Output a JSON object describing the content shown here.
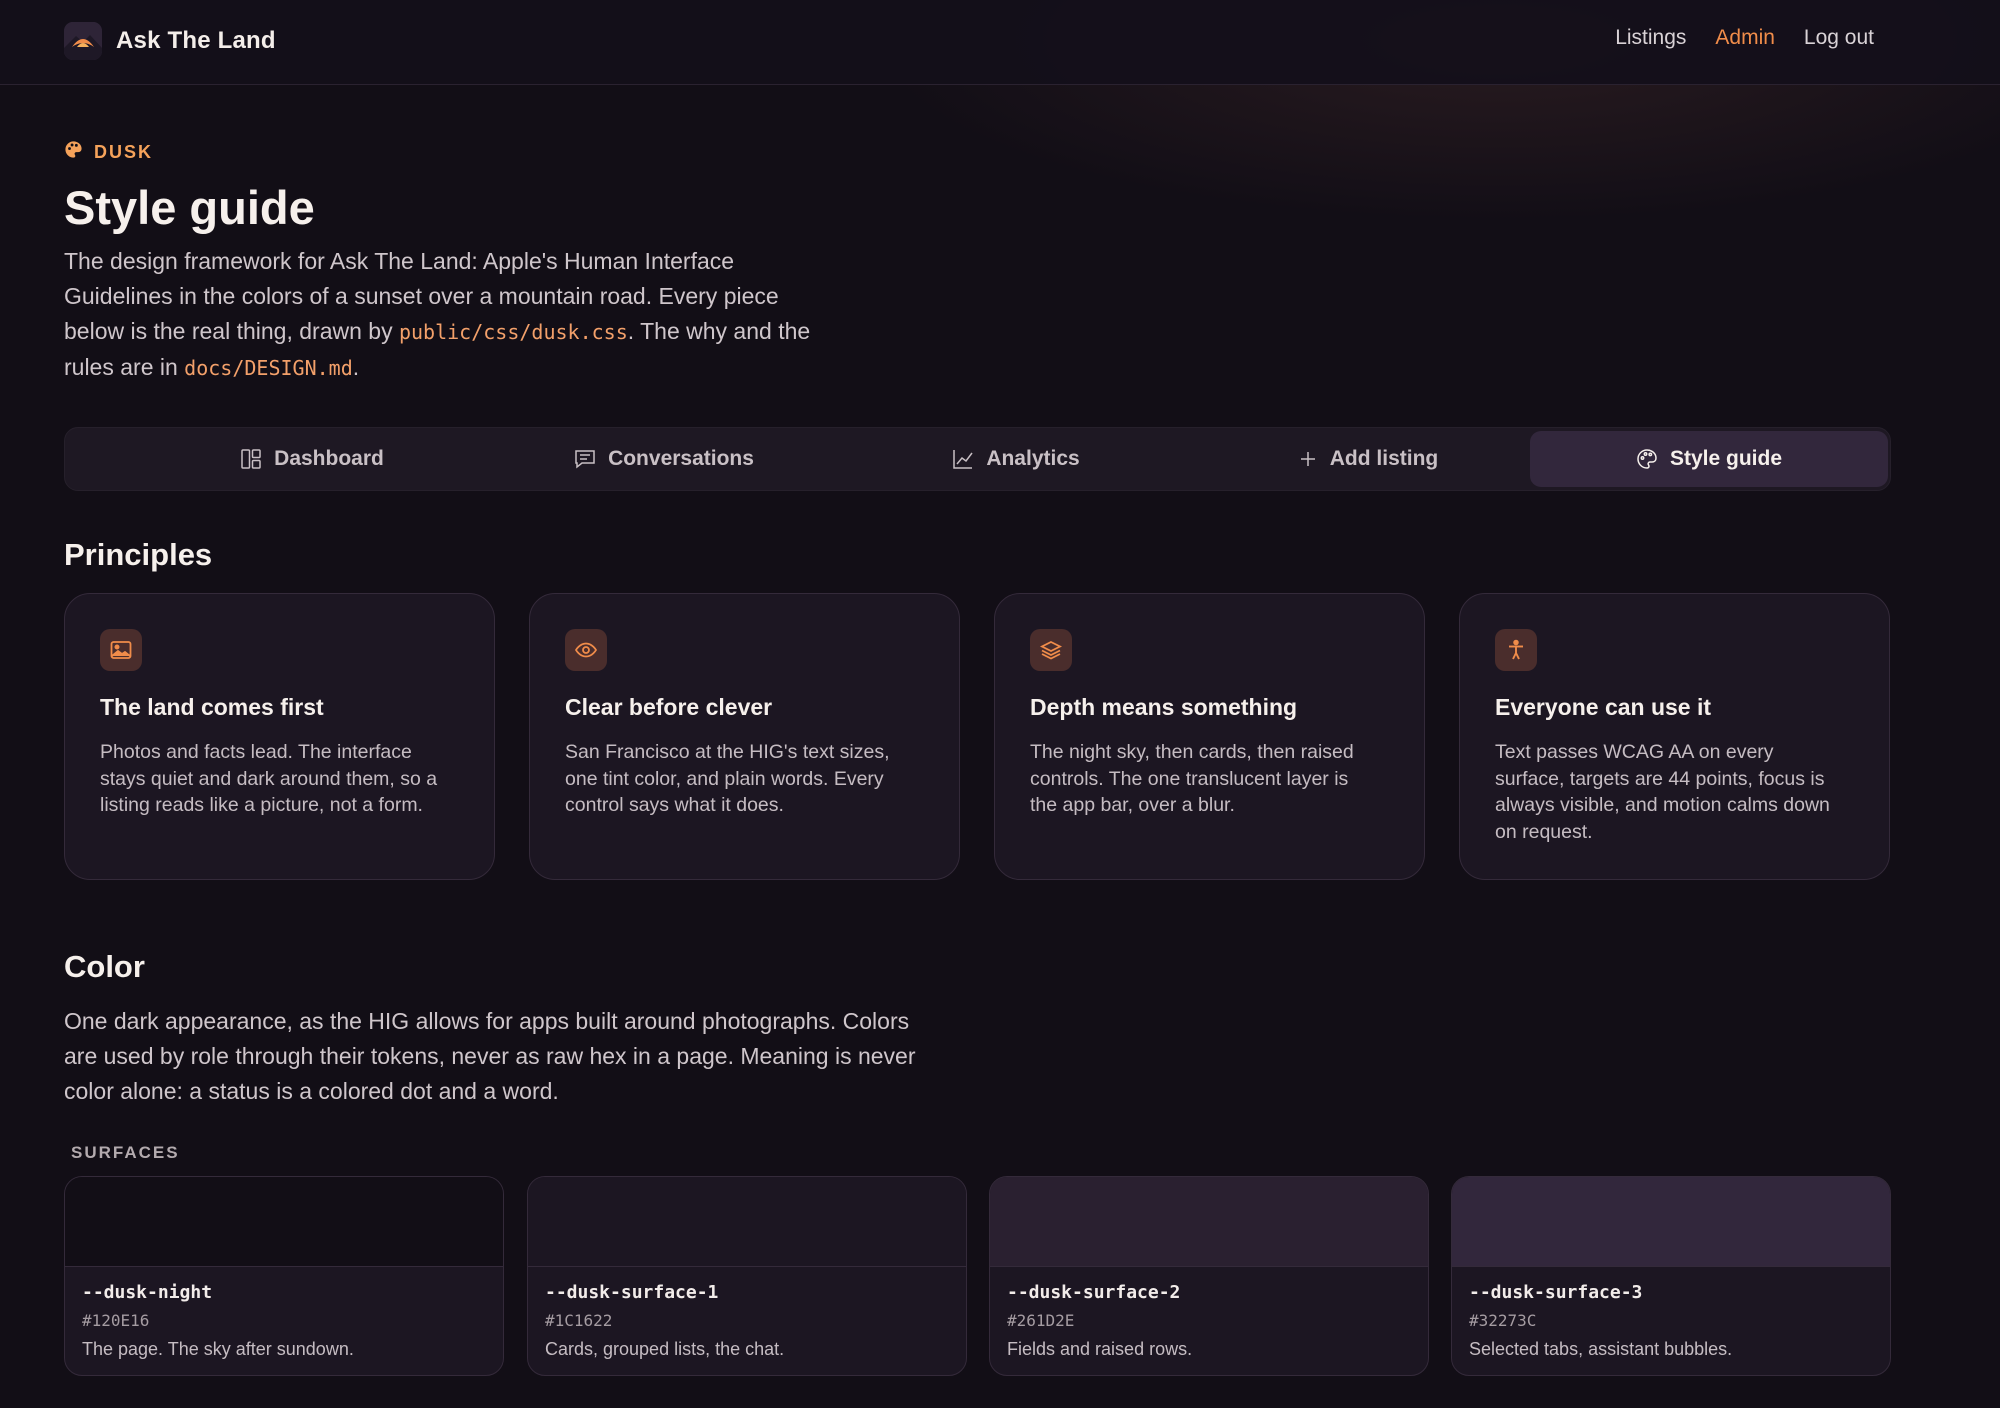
{
  "appbar": {
    "brand": "Ask The Land",
    "nav": [
      {
        "label": "Listings",
        "active": false
      },
      {
        "label": "Admin",
        "active": true
      },
      {
        "label": "Log out",
        "active": false
      }
    ]
  },
  "hero": {
    "eyebrow": "DUSK",
    "title": "Style guide",
    "lede_1": "The design framework for Ask The Land: Apple's Human Interface Guidelines in the colors of a sunset over a mountain road. Every piece below is the real thing, drawn by ",
    "lede_code_1": "public/css/dusk.css",
    "lede_2": ". The why and the rules are in ",
    "lede_code_2": "docs/DESIGN.md",
    "lede_3": "."
  },
  "tabs": [
    {
      "label": "Dashboard",
      "icon": "dashboard-icon",
      "selected": false
    },
    {
      "label": "Conversations",
      "icon": "chat-icon",
      "selected": false
    },
    {
      "label": "Analytics",
      "icon": "chart-icon",
      "selected": false
    },
    {
      "label": "Add listing",
      "icon": "plus-icon",
      "selected": false
    },
    {
      "label": "Style guide",
      "icon": "palette-icon",
      "selected": true
    }
  ],
  "principles": {
    "heading": "Principles",
    "cards": [
      {
        "icon": "image-icon",
        "title": "The land comes first",
        "body": "Photos and facts lead. The interface stays quiet and dark around them, so a listing reads like a picture, not a form."
      },
      {
        "icon": "eye-icon",
        "title": "Clear before clever",
        "body": "San Francisco at the HIG's text sizes, one tint color, and plain words. Every control says what it does."
      },
      {
        "icon": "layers-icon",
        "title": "Depth means something",
        "body": "The night sky, then cards, then raised controls. The one translucent layer is the app bar, over a blur."
      },
      {
        "icon": "accessibility-icon",
        "title": "Everyone can use it",
        "body": "Text passes WCAG AA on every surface, targets are 44 points, focus is always visible, and motion calms down on request."
      }
    ]
  },
  "color": {
    "heading": "Color",
    "lede": "One dark appearance, as the HIG allows for apps built around photographs. Colors are used by role through their tokens, never as raw hex in a page. Meaning is never color alone: a status is a colored dot and a word.",
    "surfaces_label": "SURFACES",
    "surfaces": [
      {
        "token": "--dusk-night",
        "hex": "#120E16",
        "use": "The page. The sky after sundown."
      },
      {
        "token": "--dusk-surface-1",
        "hex": "#1C1622",
        "use": "Cards, grouped lists, the chat."
      },
      {
        "token": "--dusk-surface-2",
        "hex": "#261D2E",
        "use": "Fields and raised rows."
      },
      {
        "token": "--dusk-surface-3",
        "hex": "#32273C",
        "use": "Selected tabs, assistant bubbles."
      }
    ]
  },
  "accent_color": "#F08C4A"
}
